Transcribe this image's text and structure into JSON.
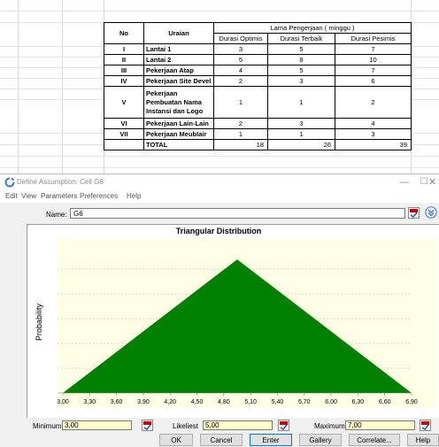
{
  "sheet": {
    "header": {
      "no": "No",
      "uraian": "Uraian",
      "group": "Lama Pengerjaan ( minggu )",
      "optimis": "Durasi Optimis",
      "terbaik": "Durasi Terbaik",
      "pesimis": "Durasi Pesimis"
    },
    "rows": [
      {
        "no": "I",
        "uraian": "Lantai 1",
        "opt": "3",
        "best": "5",
        "pes": "7"
      },
      {
        "no": "II",
        "uraian": "Lantai 2",
        "opt": "5",
        "best": "8",
        "pes": "10"
      },
      {
        "no": "III",
        "uraian": "Pekerjaan Atap",
        "opt": "4",
        "best": "5",
        "pes": "7"
      },
      {
        "no": "IV",
        "uraian": "Pekerjaan Site Devel",
        "opt": "2",
        "best": "3",
        "pes": "6"
      },
      {
        "no": "V",
        "uraian": "Pekerjaan Pembuatan Nama Instansi dan Logo",
        "opt": "1",
        "best": "1",
        "pes": "2"
      },
      {
        "no": "VI",
        "uraian": "Pekerjaan Lain-Lain",
        "opt": "2",
        "best": "3",
        "pes": "4"
      },
      {
        "no": "VII",
        "uraian": "Pekerjaan Meublair",
        "opt": "1",
        "best": "1",
        "pes": "3"
      }
    ],
    "total": {
      "label": "TOTAL",
      "opt": "18",
      "best": "26",
      "pes": "39"
    }
  },
  "dialog": {
    "title": "Define Assumption: Cell G6",
    "menus": [
      "Edit",
      "View",
      "Parameters",
      "Preferences",
      "Help"
    ],
    "name_label": "Name:",
    "name_value": "G6",
    "minimum_label": "Minimum",
    "minimum_value": "3,00",
    "likeliest_label": "Likeliest",
    "likeliest_value": "5,00",
    "maximum_label": "Maximum",
    "maximum_value": "7,00",
    "buttons": {
      "ok": "OK",
      "cancel": "Cancel",
      "enter": "Enter",
      "gallery": "Gallery",
      "correlate": "Correlate...",
      "help": "Help"
    }
  },
  "chart_data": {
    "type": "area",
    "title": "Triangular Distribution",
    "ylabel": "Probability",
    "xlabel": "",
    "x": [
      3.0,
      5.0,
      7.0
    ],
    "y": [
      0,
      1,
      0
    ],
    "xlim": [
      3.0,
      7.0
    ],
    "ylim": [
      0,
      1.1
    ],
    "tick_labels": [
      "3,00",
      "3,30",
      "3,60",
      "3,90",
      "4,20",
      "4,50",
      "4,80",
      "5,10",
      "5,40",
      "5,70",
      "6,00",
      "6,30",
      "6,60",
      "6,90"
    ],
    "grid": "horizontal dashed",
    "plot_background": "#ffffe6",
    "fill_color": "#008000"
  }
}
